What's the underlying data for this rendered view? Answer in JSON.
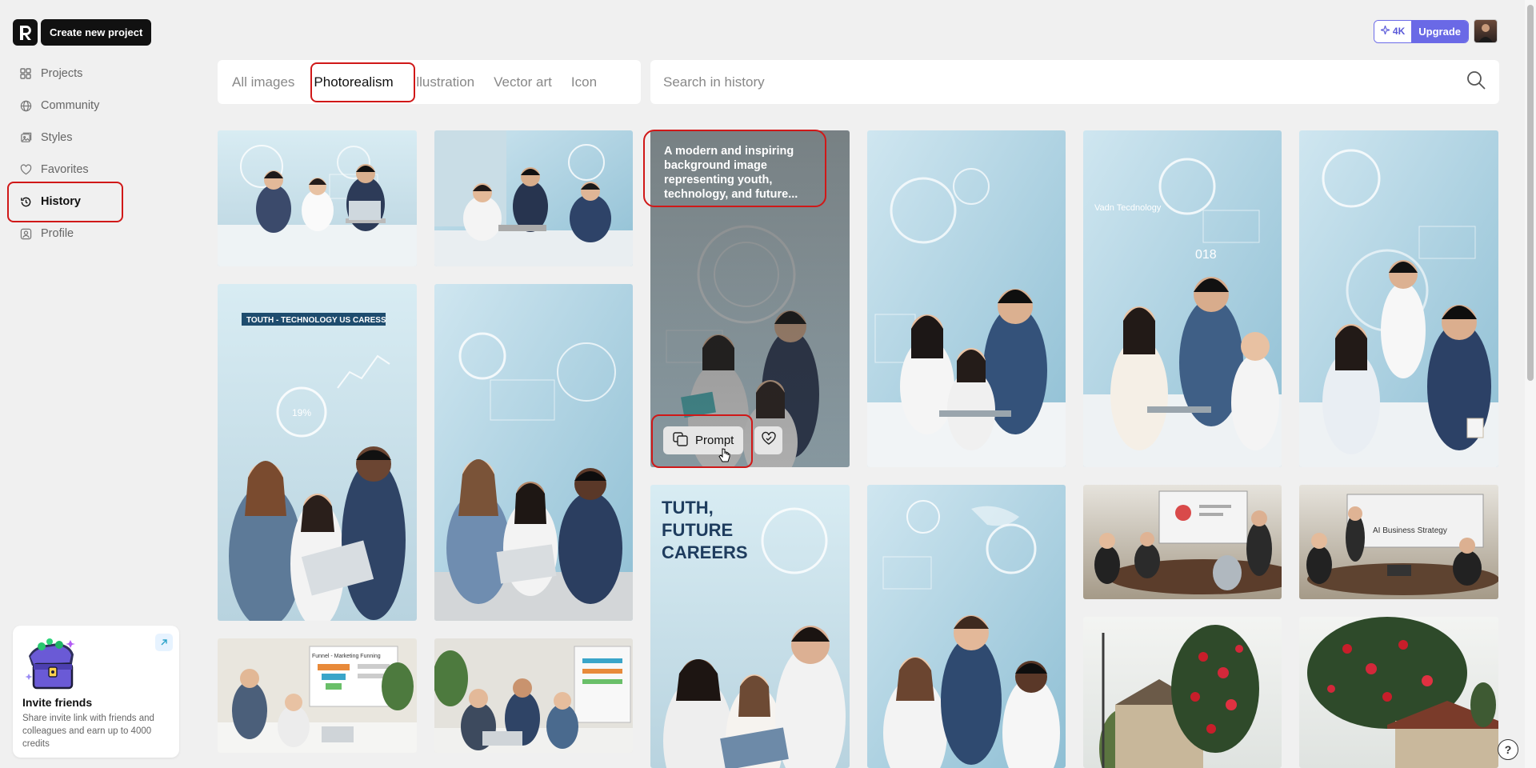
{
  "header": {
    "create_label": "Create new project",
    "credits_value": "4K",
    "upgrade_label": "Upgrade"
  },
  "sidebar": {
    "items": [
      {
        "label": "Projects",
        "icon": "grid-icon"
      },
      {
        "label": "Community",
        "icon": "globe-icon"
      },
      {
        "label": "Styles",
        "icon": "styles-icon"
      },
      {
        "label": "Favorites",
        "icon": "heart-icon"
      },
      {
        "label": "History",
        "icon": "history-icon"
      },
      {
        "label": "Profile",
        "icon": "profile-icon"
      }
    ],
    "active": "History"
  },
  "invite": {
    "title": "Invite friends",
    "description": "Share invite link with friends and colleagues and earn up to 4000 credits"
  },
  "filters": {
    "tabs": [
      "All images",
      "Photorealism",
      "Illustration",
      "Vector art",
      "Icon"
    ],
    "active": "Photorealism"
  },
  "search": {
    "placeholder": "Search in history"
  },
  "hovered_card": {
    "caption": "A modern and inspiring background image representing youth, technology, and future...",
    "prompt_label": "Prompt"
  },
  "image_texts": {
    "poster1": "TOUTH - TECHNOLOGY US CARESS",
    "poster1_pct": "19%",
    "poster2": "TUTH, FUTURE CAREERS",
    "screen_funnel": "Funnel - Marketing Funning",
    "screen_ai": "AI Business Strategy",
    "wall_label": "Vadn Tecdnology",
    "wall_num": "018"
  },
  "colors": {
    "accent": "#6a69e6",
    "highlight": "#d01818"
  }
}
